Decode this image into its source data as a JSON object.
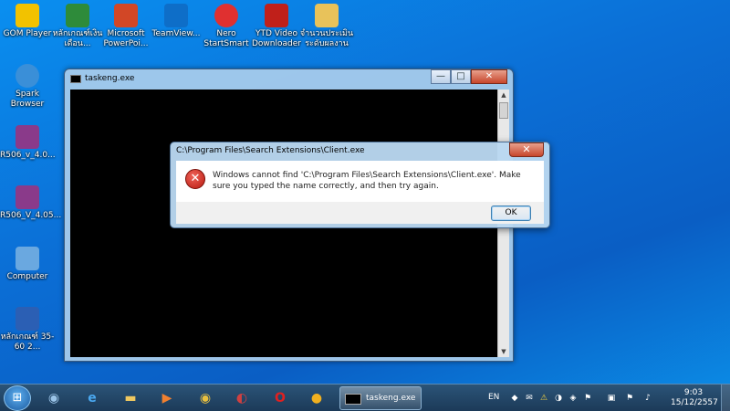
{
  "desktop": {
    "icons": [
      {
        "label": "GOM Player",
        "icon": "gom-player-icon",
        "color": "#f2c200"
      },
      {
        "label": "หลักเกณฑ์เงินเดือน...",
        "icon": "excel-icon",
        "color": "#2e8b3a"
      },
      {
        "label": "Microsoft PowerPoi...",
        "icon": "powerpoint-icon",
        "color": "#d24726"
      },
      {
        "label": "TeamView...",
        "icon": "teamviewer-icon",
        "color": "#0e6ec8"
      },
      {
        "label": "Nero StartSmart",
        "icon": "nero-icon",
        "color": "#e03030"
      },
      {
        "label": "YTD Video Downloader",
        "icon": "ytd-icon",
        "color": "#c0201a"
      },
      {
        "label": "จำนวนประเมิน ระดับผลงาน",
        "icon": "folder-icon",
        "color": "#e8c25a"
      },
      {
        "label": "Spark Browser",
        "icon": "spark-browser-icon",
        "color": "#3a8fd8"
      },
      {
        "label": "R506_v_4.0...",
        "icon": "winrar-icon",
        "color": "#8a3a8a"
      },
      {
        "label": "R506_V_4.05...",
        "icon": "winrar-icon",
        "color": "#8a3a8a"
      },
      {
        "label": "Computer",
        "icon": "computer-icon",
        "color": "#6aa8e0"
      },
      {
        "label": "หลักเกณฑ์ 35-60 2...",
        "icon": "word-doc-icon",
        "color": "#2b5fb4"
      }
    ]
  },
  "console_window": {
    "title": "taskeng.exe",
    "minimize": "—",
    "maximize": "□",
    "close": "✕"
  },
  "error_dialog": {
    "title": "C:\\Program Files\\Search Extensions\\Client.exe",
    "close": "✕",
    "icon": "error-icon",
    "icon_glyph": "✕",
    "message": "Windows cannot find 'C:\\Program Files\\Search Extensions\\Client.exe'. Make sure you typed the name correctly, and then try again.",
    "ok_label": "OK"
  },
  "taskbar": {
    "start_glyph": "⊞",
    "pinned": [
      {
        "name": "pinned-app-icon",
        "glyph": "◉",
        "color": "#9bc4e8"
      },
      {
        "name": "internet-explorer-icon",
        "glyph": "e",
        "color": "#4aa8f0"
      },
      {
        "name": "explorer-folder-icon",
        "glyph": "▬",
        "color": "#f0c860"
      },
      {
        "name": "media-player-icon",
        "glyph": "▶",
        "color": "#f08030"
      },
      {
        "name": "chrome-icon",
        "glyph": "◉",
        "color": "#e8c040"
      },
      {
        "name": "spark-icon",
        "glyph": "◐",
        "color": "#d04040"
      },
      {
        "name": "opera-icon",
        "glyph": "O",
        "color": "#e02020"
      },
      {
        "name": "gom-icon",
        "glyph": "●",
        "color": "#f0b020"
      }
    ],
    "active_task": {
      "label": "taskeng.exe"
    },
    "tray": {
      "language": "EN",
      "icons": [
        "◆",
        "✉",
        "⚠",
        "◑",
        "◈",
        "⚑",
        "▣",
        "⚑",
        "♪"
      ],
      "time": "9:03",
      "date": "15/12/2557"
    }
  }
}
